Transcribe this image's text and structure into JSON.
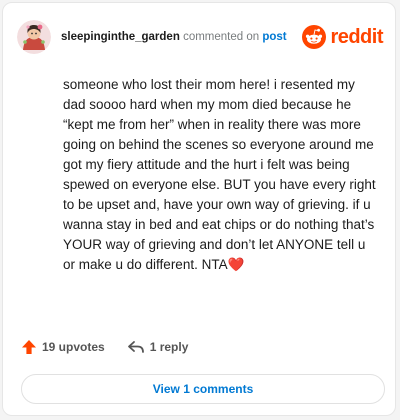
{
  "comment": {
    "username": "sleepinginthe_garden",
    "action_text": "commented on",
    "post_link": "post",
    "body": "someone who lost their mom here! i resented my dad soooo hard when my mom died because he “kept me from her” when in reality there was more going on behind the scenes so everyone around me got my fiery attitude and the hurt i felt was being spewed on everyone else. BUT you have every right to be upset and, have your own way of grieving. if u wanna stay in bed and eat chips or do nothing that’s YOUR way of grieving and don’t let ANYONE tell u or make u do different. NTA",
    "body_emoji": "❤️"
  },
  "brand": {
    "name": "reddit",
    "icon": "reddit-snoo-icon",
    "color": "#ff4500"
  },
  "actions": {
    "upvotes_label": "19 upvotes",
    "upvote_icon": "upvote-arrow-icon",
    "upvote_color": "#ff4500",
    "reply_label": "1 reply",
    "reply_icon": "reply-arrow-icon"
  },
  "footer": {
    "view_comments_label": "View 1 comments"
  },
  "colors": {
    "link": "#0079d3",
    "text": "#1c1c1c",
    "muted": "#787c7e"
  }
}
